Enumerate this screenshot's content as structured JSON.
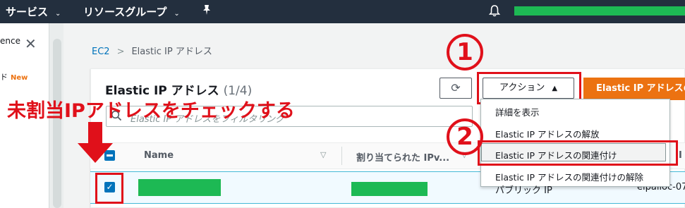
{
  "topbar": {
    "services_label": "サービス",
    "resource_groups_label": "リソースグループ",
    "chevron": "⌄"
  },
  "sidepanel": {
    "partial_text": "ence",
    "partial_text2": "ド",
    "new_badge": "New"
  },
  "breadcrumb": {
    "root": "EC2",
    "separator": ">",
    "current": "Elastic IP アドレス"
  },
  "panel": {
    "title": "Elastic IP アドレス",
    "count": "(1/4)",
    "action_button": "アクション",
    "action_caret": "▲",
    "allocate_button": "Elastic IP アドレスの割り当て",
    "search_placeholder": "Elastic IP アドレスをフィルタリング"
  },
  "annotation": {
    "instruction": "未割当IPアドレスをチェックする",
    "step1": "1",
    "step2": "2",
    "highlight_color": "#e0101a"
  },
  "table": {
    "columns": [
      {
        "label": "Name"
      },
      {
        "label": "割り当てられた IPv..."
      },
      {
        "label": "I"
      }
    ],
    "row": {
      "selected": true,
      "partial_value": "eipalloc-07"
    }
  },
  "action_menu": {
    "items": [
      {
        "label": "詳細を表示"
      },
      {
        "label": "Elastic IP アドレスの解放"
      },
      {
        "label": "Elastic IP アドレスの関連付け"
      },
      {
        "label": "Elastic IP アドレスの関連付けの解除"
      }
    ],
    "partial_below": "パブリック IP"
  },
  "colors": {
    "header_bg": "#232f3e",
    "accent_orange": "#ec7211",
    "link_blue": "#0073bb",
    "redacted_green": "#1db954"
  }
}
